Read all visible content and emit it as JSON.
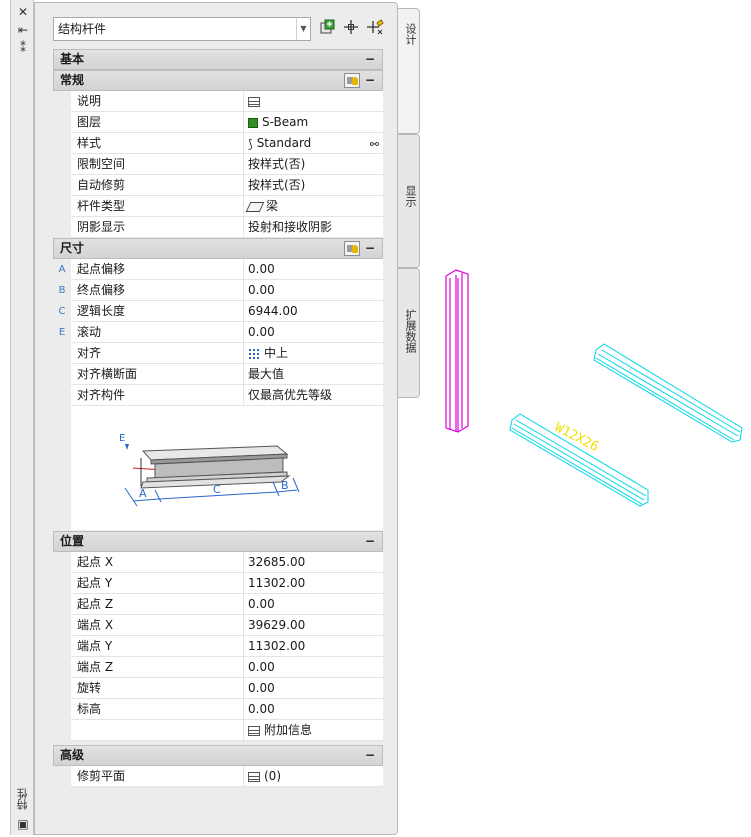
{
  "title_strip": {
    "title": "特性",
    "close": "✕",
    "pin": "⇤",
    "options": "⁑",
    "bottom_icon": "▣"
  },
  "toolbar": {
    "object_type": "结构杆件",
    "dropdown_icon": "chevron-down-icon",
    "buttons": [
      "add-to-selection-icon",
      "quick-select-icon",
      "select-objects-icon"
    ]
  },
  "tabs": [
    "设计",
    "显示",
    "扩展数据"
  ],
  "sections": {
    "basic": {
      "label": "基本",
      "collapse": "−"
    },
    "general": {
      "label": "常规",
      "collapse": "−",
      "rows": [
        {
          "name": "说明",
          "value": ""
        },
        {
          "name": "图层",
          "value": "S-Beam"
        },
        {
          "name": "样式",
          "value": "Standard"
        },
        {
          "name": "限制空间",
          "value": "按样式(否)"
        },
        {
          "name": "自动修剪",
          "value": "按样式(否)"
        },
        {
          "name": "杆件类型",
          "value": "梁"
        },
        {
          "name": "阴影显示",
          "value": "投射和接收阴影"
        }
      ]
    },
    "dimensions": {
      "label": "尺寸",
      "collapse": "−",
      "rows": [
        {
          "key": "A",
          "name": "起点偏移",
          "value": "0.00"
        },
        {
          "key": "B",
          "name": "终点偏移",
          "value": "0.00"
        },
        {
          "key": "C",
          "name": "逻辑长度",
          "value": "6944.00"
        },
        {
          "key": "E",
          "name": "滚动",
          "value": "0.00"
        },
        {
          "key": "",
          "name": "对齐",
          "value": "中上"
        },
        {
          "key": "",
          "name": "对齐横断面",
          "value": "最大值"
        },
        {
          "key": "",
          "name": "对齐构件",
          "value": "仅最高优先等级"
        }
      ],
      "diagram_labels": {
        "e": "E",
        "a": "A",
        "c": "C",
        "b": "B"
      }
    },
    "location": {
      "label": "位置",
      "collapse": "−",
      "rows": [
        {
          "name": "起点 X",
          "value": "32685.00"
        },
        {
          "name": "起点 Y",
          "value": "11302.00"
        },
        {
          "name": "起点 Z",
          "value": "0.00"
        },
        {
          "name": "端点 X",
          "value": "39629.00"
        },
        {
          "name": "端点 Y",
          "value": "11302.00"
        },
        {
          "name": "端点 Z",
          "value": "0.00"
        },
        {
          "name": "旋转",
          "value": "0.00"
        },
        {
          "name": "标高",
          "value": "0.00"
        },
        {
          "name": "",
          "value": "附加信息"
        }
      ]
    },
    "advanced": {
      "label": "高级",
      "collapse": "−",
      "rows": [
        {
          "name": "修剪平面",
          "value": "(0)"
        }
      ]
    }
  },
  "model": {
    "beam_tag": "W12X26",
    "colors": {
      "selected": "#e000e0",
      "beams": "#00d8e8",
      "tag": "#f0e000"
    }
  }
}
